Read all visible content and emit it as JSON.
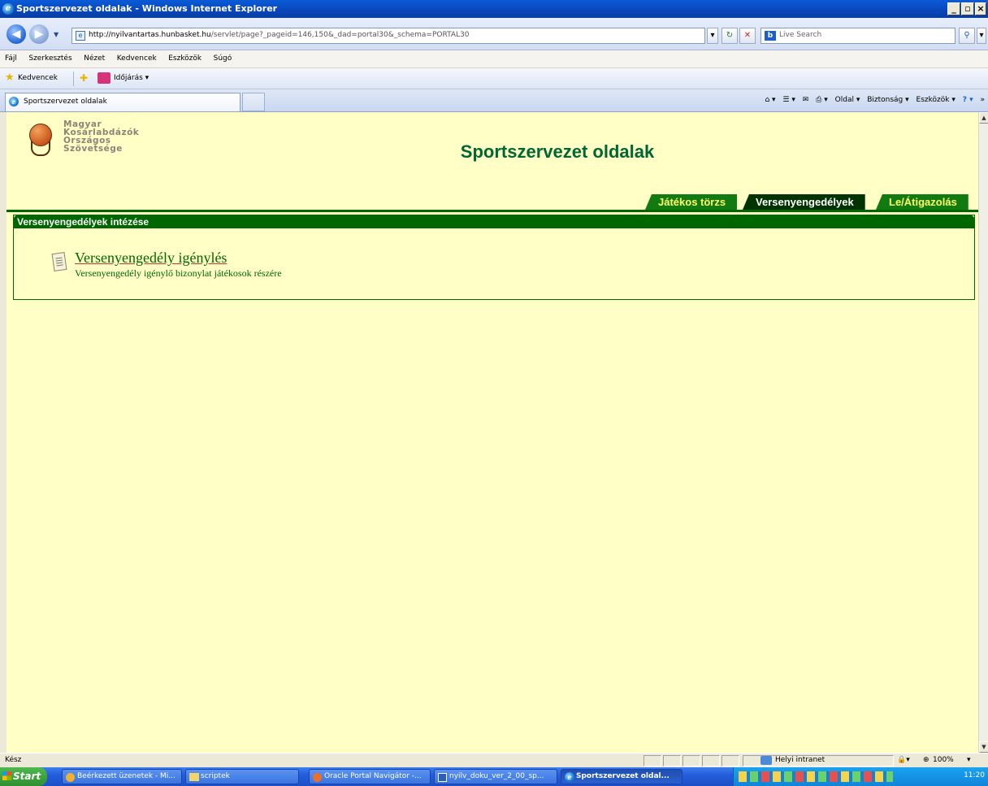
{
  "window": {
    "title": "Sportszervezet oldalak - Windows Internet Explorer"
  },
  "address": {
    "url_host": "http://nyilvantartas.hunbasket.hu",
    "url_path": "/servlet/page?_pageid=146,150&_dad=portal30&_schema=PORTAL30",
    "search_placeholder": "Live Search"
  },
  "menu": [
    "Fájl",
    "Szerkesztés",
    "Nézet",
    "Kedvencek",
    "Eszközök",
    "Súgó"
  ],
  "favorites": {
    "label": "Kedvencek",
    "item": "Időjárás ▾"
  },
  "browser_tab": {
    "title": "Sportszervezet oldalak"
  },
  "command_bar": [
    "Oldal ▾",
    "Biztonság ▾",
    "Eszközök ▾"
  ],
  "logo": {
    "lines": [
      "Magyar",
      "Kosárlabdázók",
      "Országos",
      "Szövetsége"
    ]
  },
  "page": {
    "title": "Sportszervezet oldalak",
    "tabs": [
      "Játékos törzs",
      "Versenyengedélyek",
      "Le/Átigazolás"
    ],
    "section_title": "Versenyengedélyek intézése",
    "link_label": "Versenyengedély igénylés",
    "link_desc": "Versenyengedély igénylő bizonylat játékosok részére"
  },
  "status": {
    "text": "Kész",
    "zone": "Helyi intranet",
    "zoom": "100%"
  },
  "taskbar": {
    "start": "Start",
    "buttons": [
      "Beérkezett üzenetek - Mi...",
      "scriptek",
      "Oracle Portal Navigátor -...",
      "nyilv_doku_ver_2_00_sp...",
      "Sportszervezet oldal..."
    ],
    "clock": "11:20"
  }
}
